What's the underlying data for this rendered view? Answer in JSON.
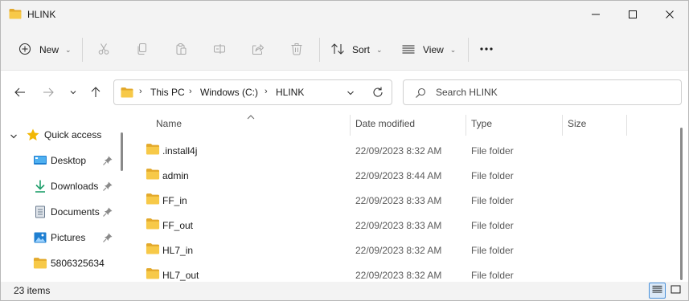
{
  "window": {
    "title": "HLINK"
  },
  "toolbar": {
    "new_label": "New",
    "sort_label": "Sort",
    "view_label": "View"
  },
  "address": {
    "crumbs": [
      "This PC",
      "Windows (C:)",
      "HLINK"
    ]
  },
  "search": {
    "placeholder": "Search HLINK"
  },
  "sidebar": {
    "quick_access_label": "Quick access",
    "items": [
      {
        "label": "Desktop",
        "icon": "desktop-icon",
        "pinned": true
      },
      {
        "label": "Downloads",
        "icon": "downloads-icon",
        "pinned": true
      },
      {
        "label": "Documents",
        "icon": "documents-icon",
        "pinned": true
      },
      {
        "label": "Pictures",
        "icon": "pictures-icon",
        "pinned": true
      },
      {
        "label": "5806325634",
        "icon": "folder-icon",
        "pinned": false
      }
    ]
  },
  "columns": {
    "name": "Name",
    "date": "Date modified",
    "type": "Type",
    "size": "Size"
  },
  "files": [
    {
      "name": ".install4j",
      "date": "22/09/2023 8:32 AM",
      "type": "File folder",
      "size": ""
    },
    {
      "name": "admin",
      "date": "22/09/2023 8:44 AM",
      "type": "File folder",
      "size": ""
    },
    {
      "name": "FF_in",
      "date": "22/09/2023 8:33 AM",
      "type": "File folder",
      "size": ""
    },
    {
      "name": "FF_out",
      "date": "22/09/2023 8:33 AM",
      "type": "File folder",
      "size": ""
    },
    {
      "name": "HL7_in",
      "date": "22/09/2023 8:32 AM",
      "type": "File folder",
      "size": ""
    },
    {
      "name": "HL7_out",
      "date": "22/09/2023 8:32 AM",
      "type": "File folder",
      "size": ""
    }
  ],
  "status": {
    "item_count": "23 items"
  },
  "colors": {
    "folder": "#f7c948",
    "folder_dark": "#e3a92b",
    "accent": "#0067c0",
    "star": "#f2b705"
  }
}
